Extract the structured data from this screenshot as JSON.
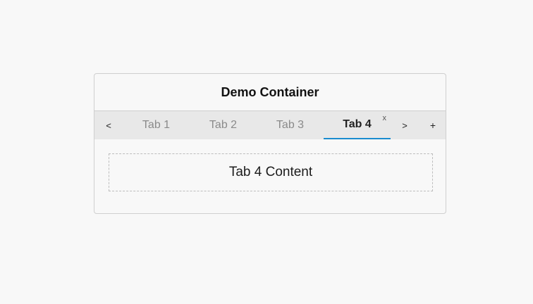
{
  "container": {
    "title": "Demo Container"
  },
  "tabbar": {
    "prev_label": "<",
    "next_label": ">",
    "add_label": "+",
    "tabs": [
      {
        "label": "Tab 1",
        "active": false
      },
      {
        "label": "Tab 2",
        "active": false
      },
      {
        "label": "Tab 3",
        "active": false
      },
      {
        "label": "Tab 4",
        "active": true,
        "close_label": "x"
      }
    ]
  },
  "content": {
    "text": "Tab 4 Content"
  },
  "colors": {
    "active_underline": "#1a8ccf",
    "tabbar_bg": "#e8e8e8",
    "page_bg": "#f8f8f8"
  }
}
